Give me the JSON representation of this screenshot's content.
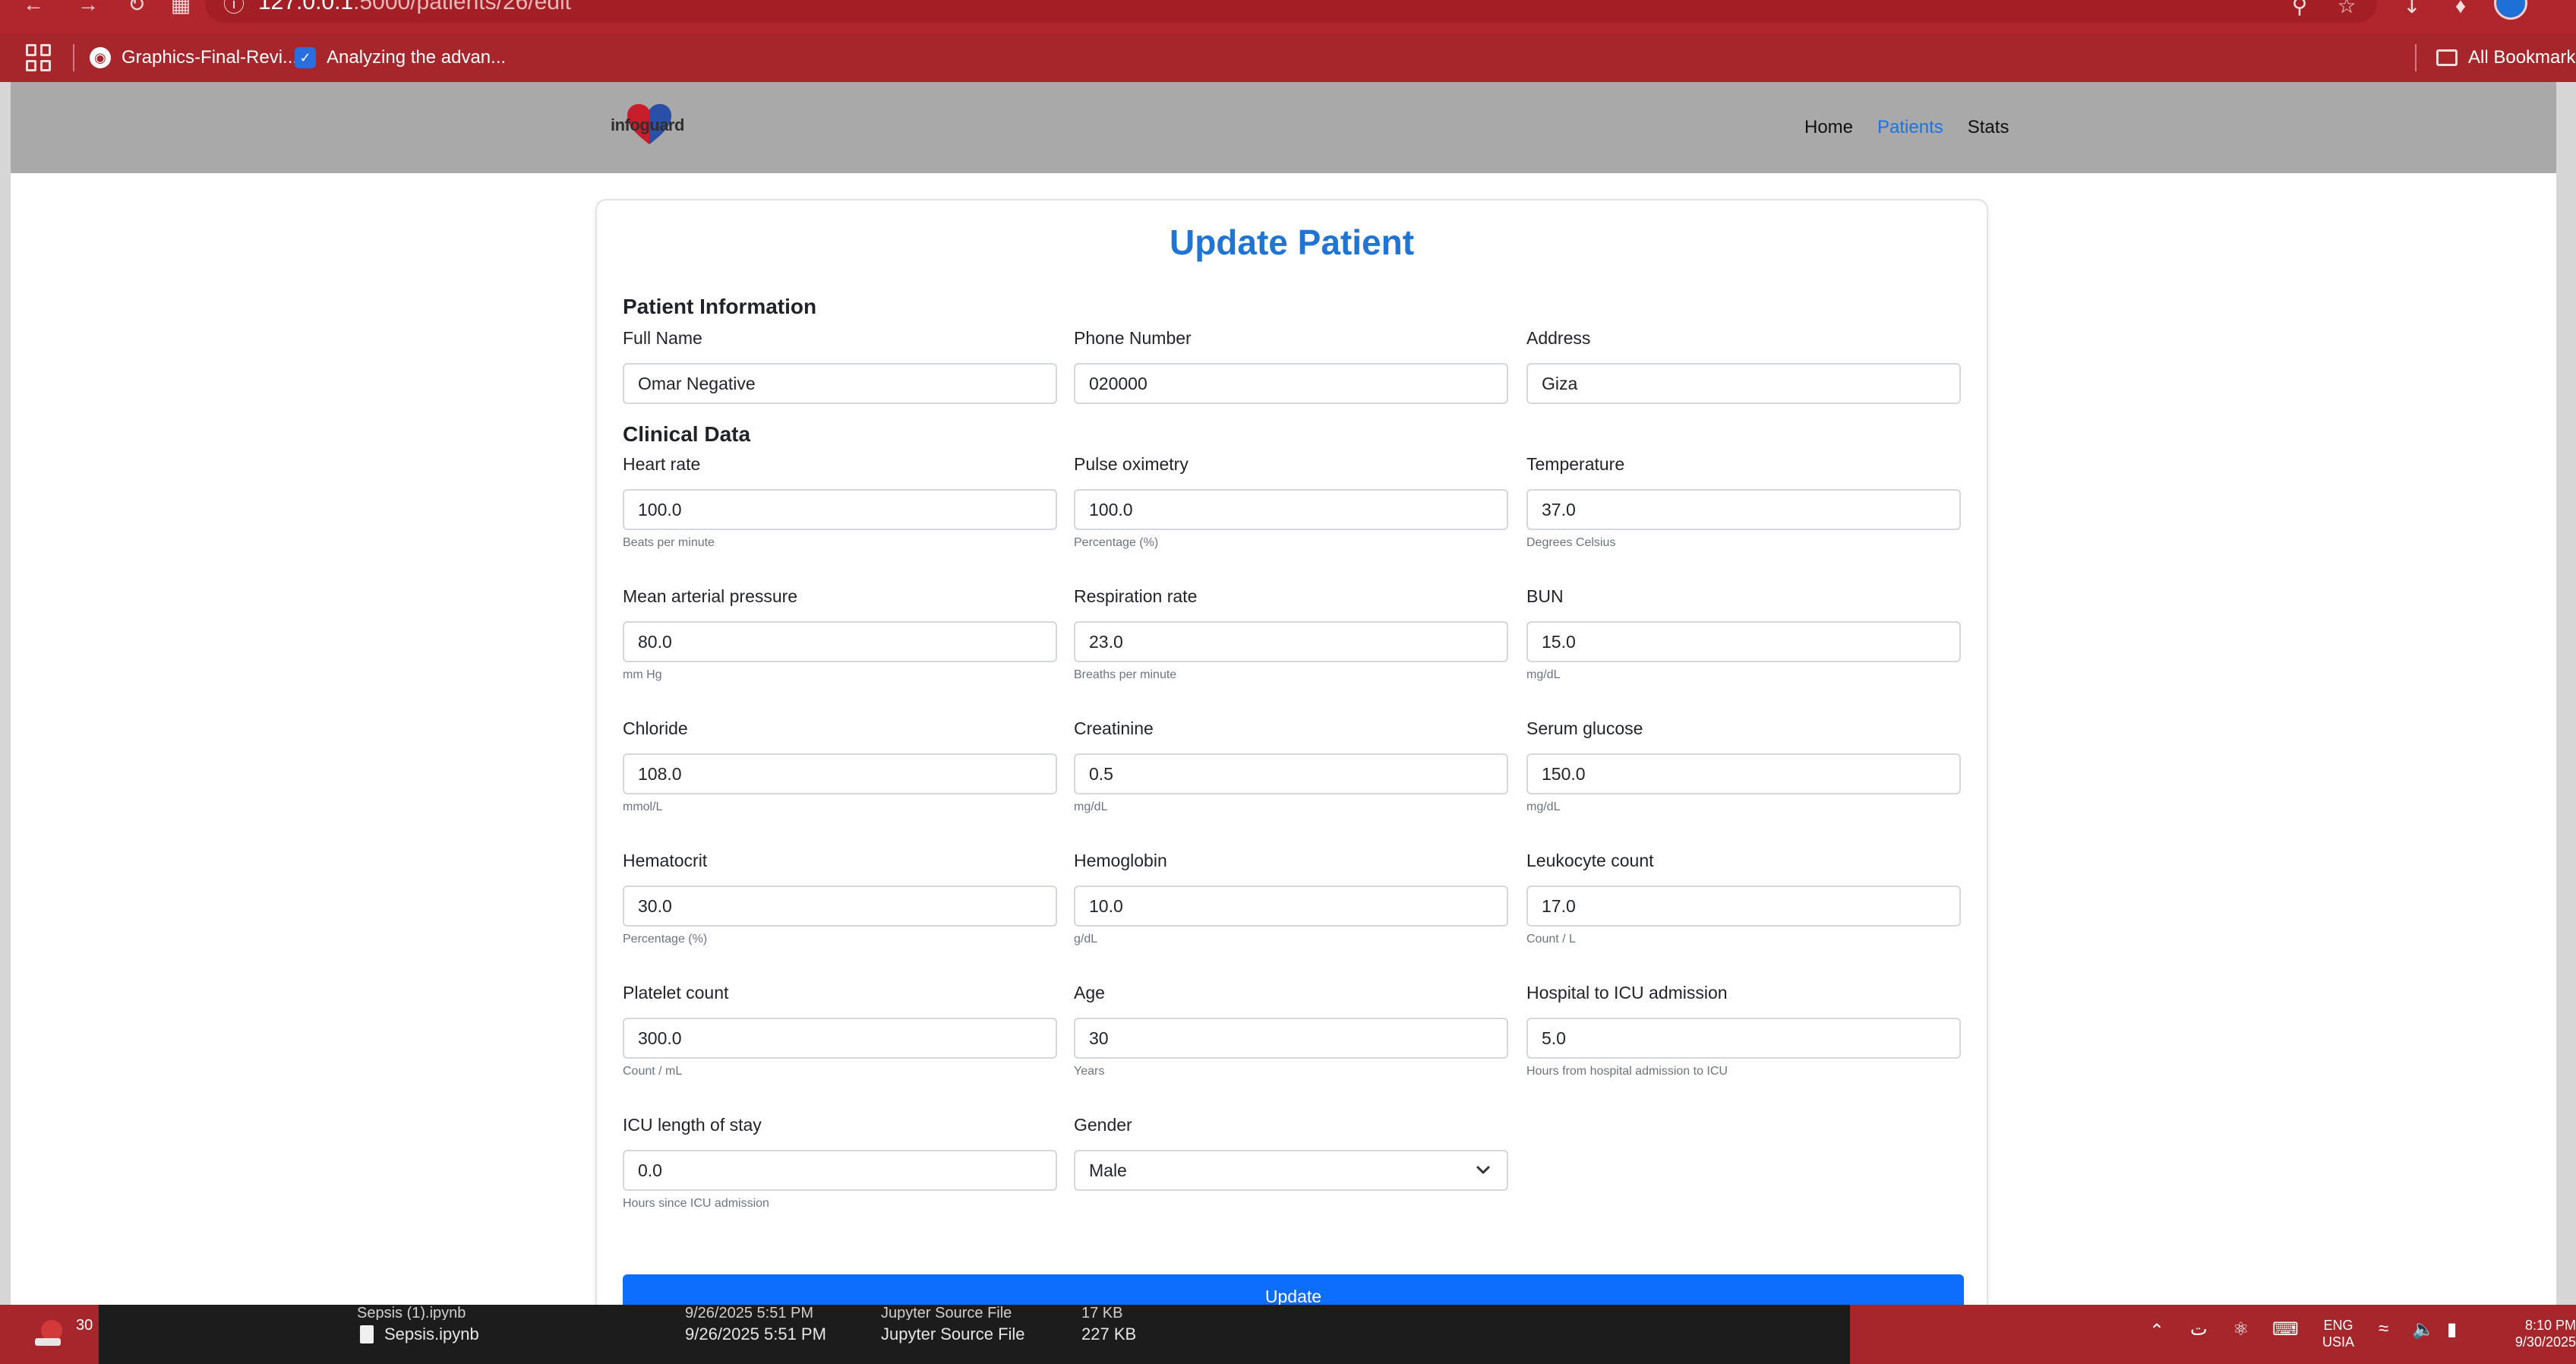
{
  "browser": {
    "url_host": "127.0.0.1",
    "url_path": ":5000/patients/26/edit",
    "bookmarks": [
      {
        "label": "Graphics-Final-Revi..."
      },
      {
        "label": "Analyzing the advan..."
      }
    ],
    "all_bookmarks": "All Bookmarks"
  },
  "navbar": {
    "logo_text": "infoguard",
    "links": [
      {
        "label": "Home"
      },
      {
        "label": "Patients"
      },
      {
        "label": "Stats"
      }
    ]
  },
  "form": {
    "title": "Update Patient",
    "section_patient": "Patient Information",
    "section_clinical": "Clinical Data",
    "fields": {
      "full_name": {
        "label": "Full Name",
        "value": "Omar Negative"
      },
      "phone": {
        "label": "Phone Number",
        "value": "020000"
      },
      "address": {
        "label": "Address",
        "value": "Giza"
      },
      "heart_rate": {
        "label": "Heart rate",
        "value": "100.0",
        "help": "Beats per minute"
      },
      "pulse_ox": {
        "label": "Pulse oximetry",
        "value": "100.0",
        "help": "Percentage (%)"
      },
      "temperature": {
        "label": "Temperature",
        "value": "37.0",
        "help": "Degrees Celsius"
      },
      "map": {
        "label": "Mean arterial pressure",
        "value": "80.0",
        "help": "mm Hg"
      },
      "resp_rate": {
        "label": "Respiration rate",
        "value": "23.0",
        "help": "Breaths per minute"
      },
      "bun": {
        "label": "BUN",
        "value": "15.0",
        "help": "mg/dL"
      },
      "chloride": {
        "label": "Chloride",
        "value": "108.0",
        "help": "mmol/L"
      },
      "creatinine": {
        "label": "Creatinine",
        "value": "0.5",
        "help": "mg/dL"
      },
      "glucose": {
        "label": "Serum glucose",
        "value": "150.0",
        "help": "mg/dL"
      },
      "hematocrit": {
        "label": "Hematocrit",
        "value": "30.0",
        "help": "Percentage (%)"
      },
      "hemoglobin": {
        "label": "Hemoglobin",
        "value": "10.0",
        "help": "g/dL"
      },
      "leukocyte": {
        "label": "Leukocyte count",
        "value": "17.0",
        "help": "Count / L"
      },
      "platelet": {
        "label": "Platelet count",
        "value": "300.0",
        "help": "Count / mL"
      },
      "age": {
        "label": "Age",
        "value": "30",
        "help": "Years"
      },
      "hosp_icu": {
        "label": "Hospital to ICU admission",
        "value": "5.0",
        "help": "Hours from hospital admission to ICU"
      },
      "icu_los": {
        "label": "ICU length of stay",
        "value": "0.0",
        "help": "Hours since ICU admission"
      },
      "gender": {
        "label": "Gender",
        "value": "Male"
      }
    },
    "submit_label": "Update"
  },
  "explorer": {
    "top_row": {
      "name": "Sepsis (1).ipynb",
      "date": "9/26/2025 5:51 PM",
      "type": "Jupyter Source File",
      "size": "17 KB"
    },
    "row": {
      "name": "Sepsis.ipynb",
      "date": "9/26/2025 5:51 PM",
      "type": "Jupyter Source File",
      "size": "227 KB"
    }
  },
  "taskbar": {
    "app_badge": "30",
    "lang_top": "ENG",
    "lang_bottom": "USIA",
    "time": "8:10 PM",
    "date": "9/30/2025"
  },
  "colors": {
    "browser_red": "#b1262c",
    "navbar_gray": "#a9a9a9",
    "title_blue": "#1f74d4",
    "button_blue": "#0d6efd",
    "active_link": "#1a73e8"
  }
}
